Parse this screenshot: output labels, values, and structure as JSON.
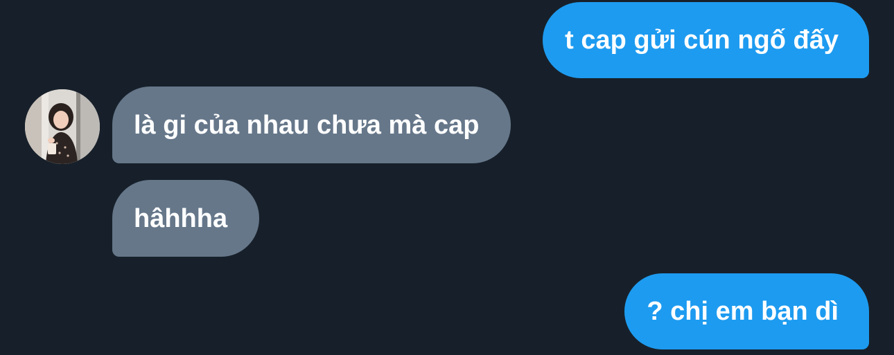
{
  "conversation": {
    "messages": [
      {
        "sender": "me",
        "text": "t cap gửi cún ngố đấy"
      },
      {
        "sender": "other",
        "text": "là gi của nhau chưa mà cap"
      },
      {
        "sender": "other",
        "text": "hâhhha"
      },
      {
        "sender": "me",
        "text": "? chị em bạn dì"
      }
    ]
  },
  "colors": {
    "background": "#17202a",
    "outgoing_bubble": "#1d9bf0",
    "incoming_bubble": "#66778a",
    "text": "#ffffff"
  },
  "icons": {
    "contact_avatar": "avatar-photo"
  }
}
